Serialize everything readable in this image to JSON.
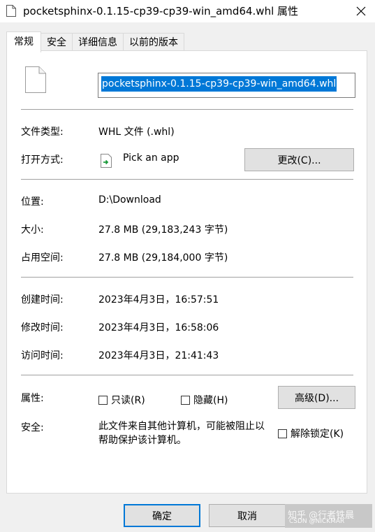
{
  "window": {
    "title": "pocketsphinx-0.1.15-cp39-cp39-win_amd64.whl 属性",
    "close_glyph": "✕"
  },
  "tabs": [
    {
      "label": "常规",
      "active": true
    },
    {
      "label": "安全",
      "active": false
    },
    {
      "label": "详细信息",
      "active": false
    },
    {
      "label": "以前的版本",
      "active": false
    }
  ],
  "file": {
    "name": "pocketsphinx-0.1.15-cp39-cp39-win_amd64.whl"
  },
  "type_section": {
    "type_label": "文件类型:",
    "type_value": "WHL 文件 (.whl)",
    "open_with_label": "打开方式:",
    "open_with_value": "Pick an app",
    "change_button": "更改(C)..."
  },
  "location_section": {
    "location_label": "位置:",
    "location_value": "D:\\Download",
    "size_label": "大小:",
    "size_value": "27.8 MB (29,183,243 字节)",
    "disk_size_label": "占用空间:",
    "disk_size_value": "27.8 MB (29,184,000 字节)"
  },
  "time_section": {
    "created_label": "创建时间:",
    "created_value": "2023年4月3日，16:57:51",
    "modified_label": "修改时间:",
    "modified_value": "2023年4月3日，16:58:06",
    "accessed_label": "访问时间:",
    "accessed_value": "2023年4月3日，21:41:43"
  },
  "attributes_section": {
    "attributes_label": "属性:",
    "readonly_label": "只读(R)",
    "readonly_checked": false,
    "hidden_label": "隐藏(H)",
    "hidden_checked": false,
    "advanced_button": "高级(D)...",
    "security_label": "安全:",
    "security_text": "此文件来自其他计算机，可能被阻止以帮助保护该计算机。",
    "unblock_label": "解除锁定(K)",
    "unblock_checked": false
  },
  "footer": {
    "ok_button": "确定",
    "cancel_button": "取消",
    "watermark_text": "知乎 @行者铁晨",
    "watermark_sub": "CSDN @NICKMAR"
  },
  "colors": {
    "selection": "#0078d7",
    "default_button_border": "#0078d7"
  }
}
